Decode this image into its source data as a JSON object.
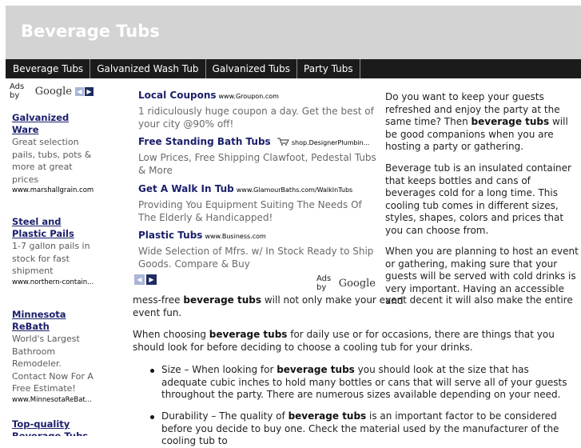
{
  "site": {
    "title": "Beverage Tubs"
  },
  "nav": [
    "Beverage Tubs",
    "Galvanized Wash Tub",
    "Galvanized Tubs",
    "Party Tubs"
  ],
  "adsby": {
    "label": "Ads by",
    "brand": "Google",
    "prev": "◀",
    "next": "▶"
  },
  "sidebar_ads": [
    {
      "title": "Galvanized Ware",
      "desc": "Great selection pails, tubs, pots & more at great prices",
      "url": "www.marshallgrain.com"
    },
    {
      "title": "Steel and Plastic Pails",
      "desc": "1-7 gallon pails in stock for fast shipment",
      "url": "www.northern-contain..."
    },
    {
      "title": "Minnesota ReBath",
      "desc": "World's Largest Bathroom Remodeler. Contact Now For A Free Estimate!",
      "url": "www.MinnesotaReBat..."
    },
    {
      "title": "Top-quality Beverage Tubs",
      "desc": "",
      "url": ""
    }
  ],
  "main_ads": [
    {
      "title": "Local Coupons",
      "url": "www.Groupon.com",
      "desc": "1 ridiculously huge coupon a day. Get the best of your city @90% off!"
    },
    {
      "title": "Free Standing Bath Tubs",
      "url": "shop.DesignerPlumbin...",
      "desc": "Low Prices, Free Shipping Clawfoot, Pedestal Tubs & More"
    },
    {
      "title": "Get A Walk In Tub",
      "url": "www.GlamourBaths.com/WalkInTubs",
      "desc": "Providing You Equipment Suiting The Needs Of The Elderly & Handicapped!"
    },
    {
      "title": "Plastic Tubs",
      "url": "www.Business.com",
      "desc": "Wide Selection of Mfrs. w/ In Stock Ready to Ship Goods. Compare & Buy"
    }
  ],
  "content": {
    "p1": "Do you want to keep your guests refreshed and enjoy the party at the same time?  Then beverage tubs will be good companions when you are hosting a party or gathering.",
    "p2": "Beverage tub is an insulated container that keeps bottles and cans of beverages cold for a long time.  This cooling tub comes in different sizes, styles, shapes, colors and prices that you can choose from.",
    "p3a": "When you are planning to host an event or gathering, making sure that your guests will be served with cold drinks is very important.  Having an accessible and",
    "p3b": "mess-free beverage tubs will not only make your event decent it will also make the entire event fun.",
    "p4": "When choosing beverage tubs for daily use or for occasions, there are things that you should look for before deciding to choose a cooling tub for your drinks.",
    "b1": "Size – When looking for beverage tubs you should look at the size that has adequate cubic inches to hold many bottles or cans that will serve all of your guests throughout the party.  There are numerous sizes available depending on your need.",
    "b2": "Durability – The quality of beverage tubs is an important factor to be considered before you decide to buy one.  Check the material used by the manufacturer of the cooling tub to"
  },
  "colors": {
    "nav_bg": "#1b1b1b",
    "header_bg": "#d3d3d3",
    "ad_title": "#1a1f6b"
  }
}
